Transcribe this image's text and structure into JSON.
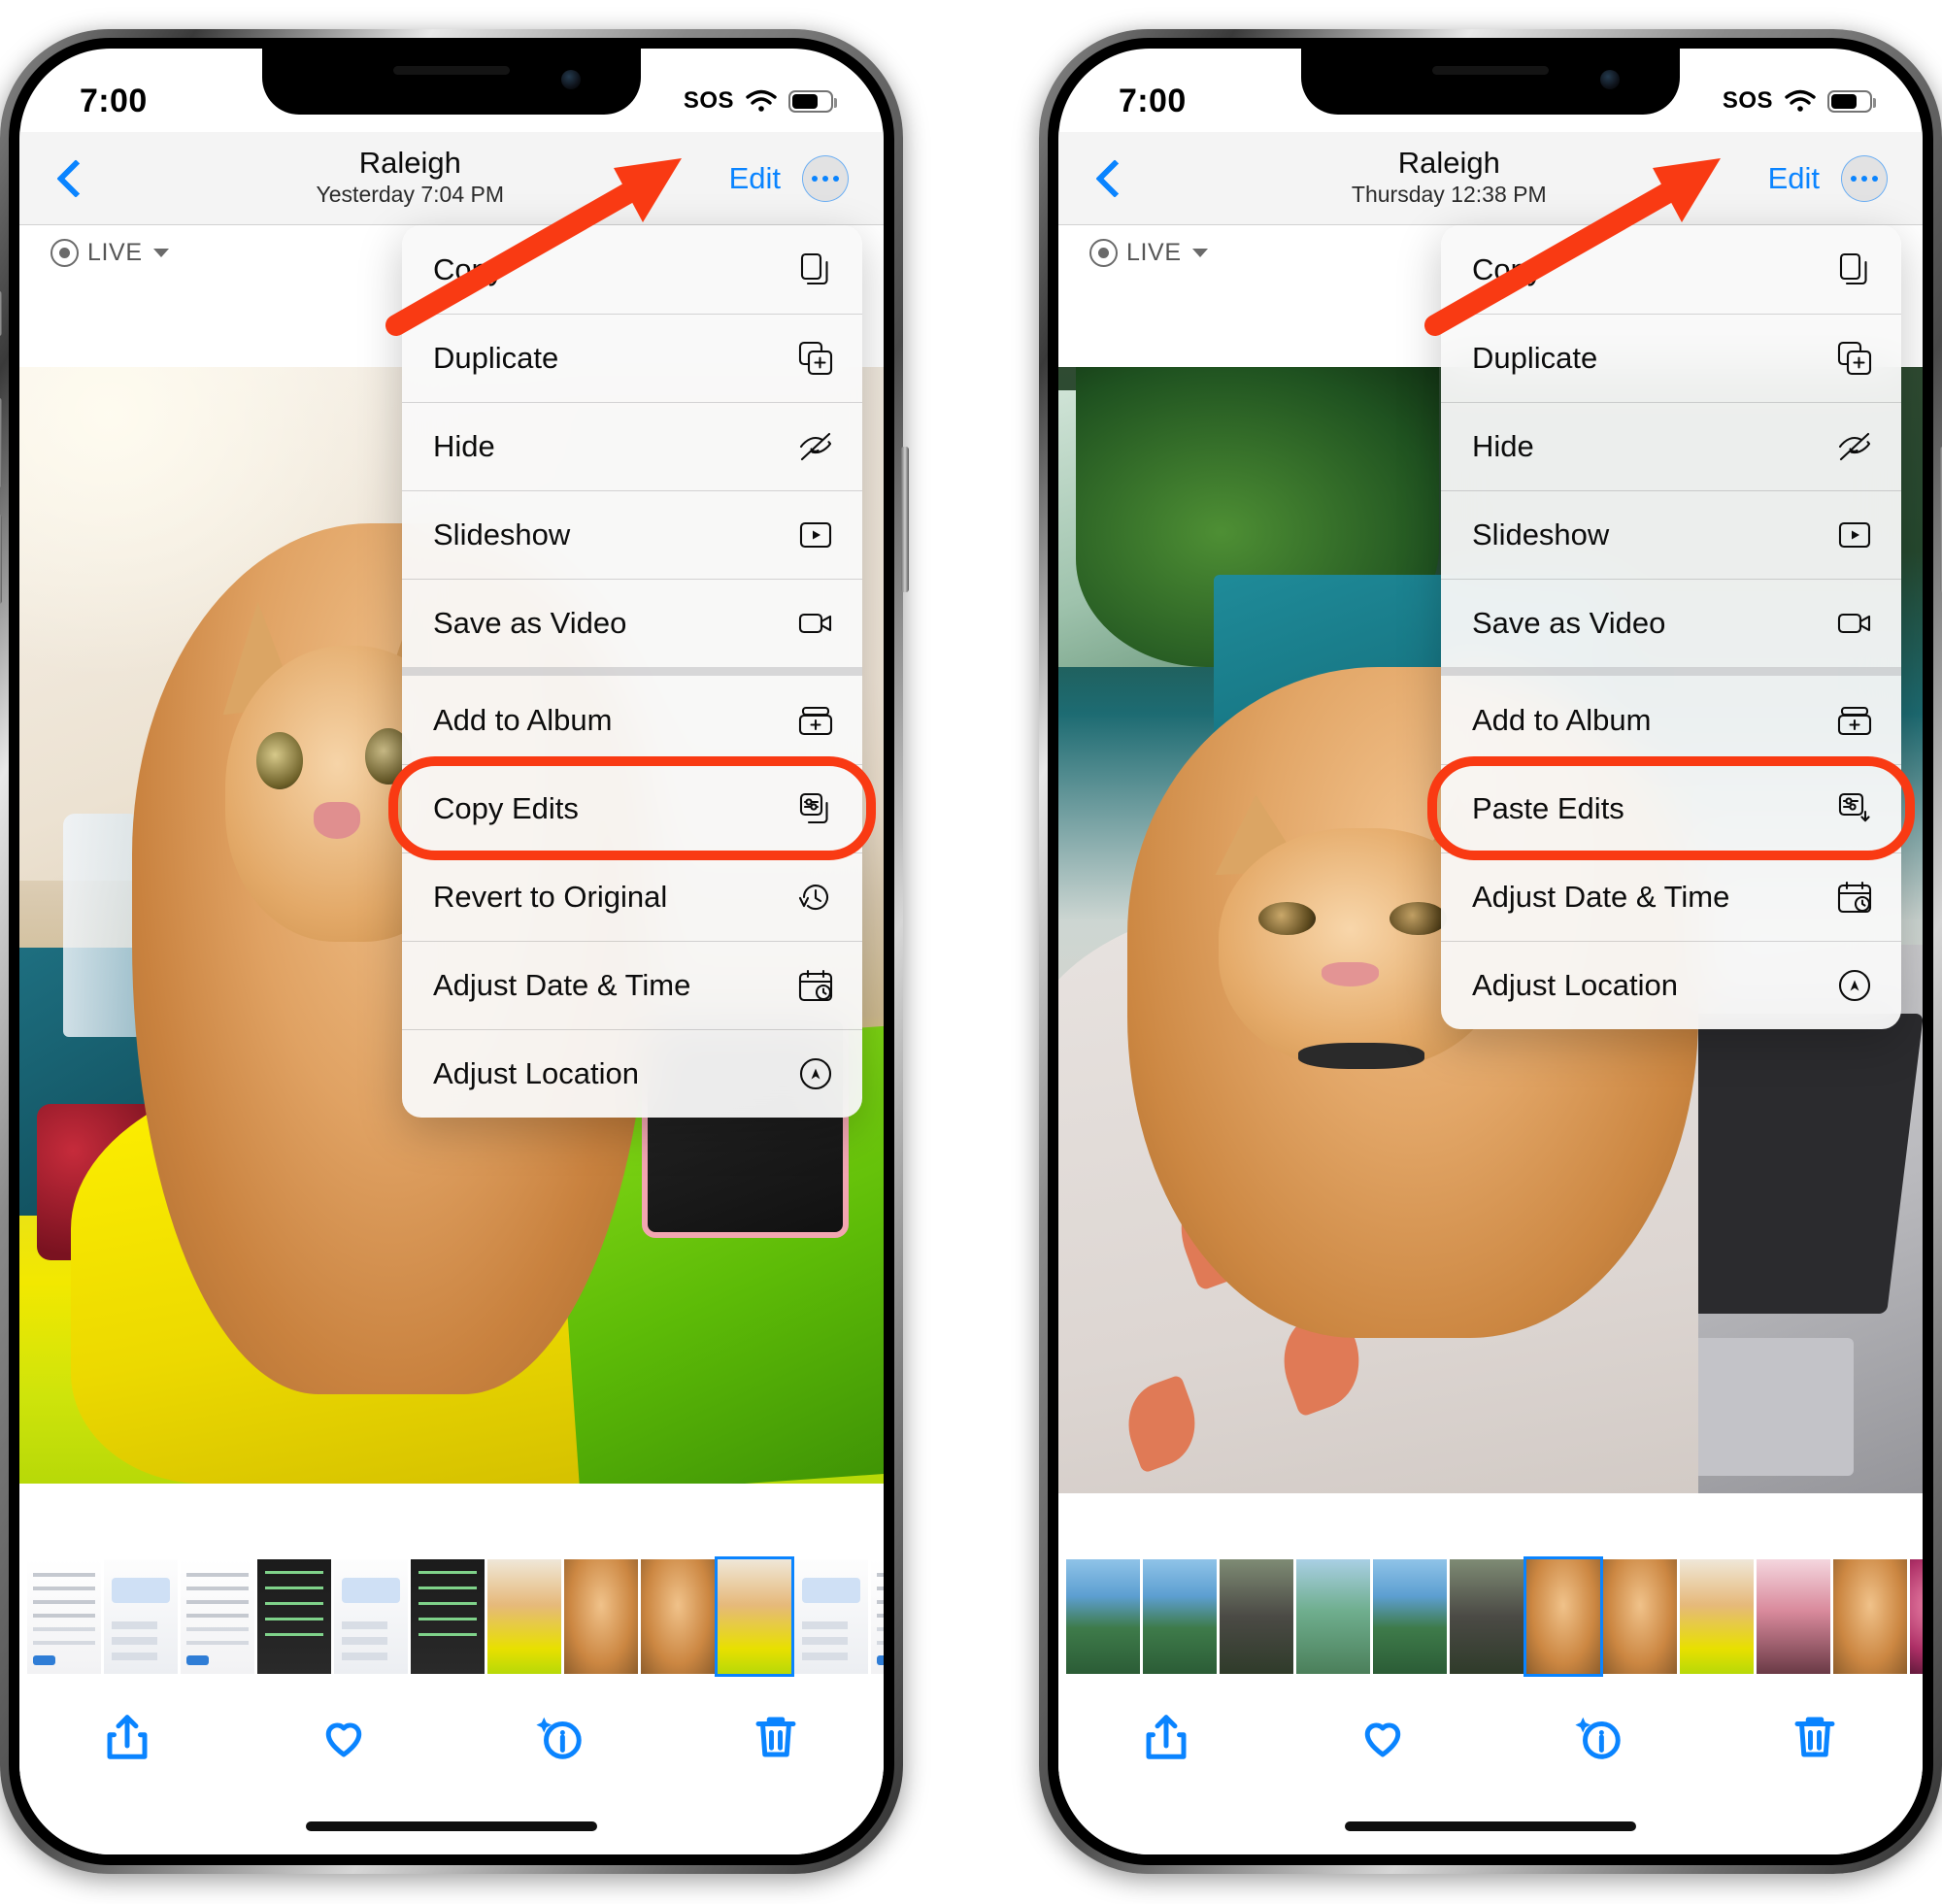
{
  "meta": {
    "accent_blue": "#0a84ff",
    "highlight_red": "#f93a13",
    "menu_bg": "#f9f9f9"
  },
  "phones": [
    {
      "id": "left",
      "status": {
        "time": "7:00",
        "sos": "SOS",
        "wifi": "wifi-icon",
        "battery": "battery-icon"
      },
      "nav": {
        "back": "back-chevron",
        "title": "Raleigh",
        "subtitle": "Yesterday  7:04 PM",
        "edit": "Edit",
        "more": "more-options"
      },
      "live_badge": {
        "label": "LIVE"
      },
      "menu": [
        [
          {
            "label": "Copy",
            "icon": "copy-icon"
          },
          {
            "label": "Duplicate",
            "icon": "duplicate-icon"
          },
          {
            "label": "Hide",
            "icon": "hide-eye-icon"
          },
          {
            "label": "Slideshow",
            "icon": "slideshow-icon"
          },
          {
            "label": "Save as Video",
            "icon": "video-camera-icon"
          }
        ],
        [
          {
            "label": "Add to Album",
            "icon": "add-to-album-icon"
          },
          {
            "label": "Copy Edits",
            "icon": "copy-edits-icon",
            "highlighted": true
          },
          {
            "label": "Revert to Original",
            "icon": "revert-icon"
          },
          {
            "label": "Adjust Date & Time",
            "icon": "calendar-clock-icon"
          },
          {
            "label": "Adjust Location",
            "icon": "location-icon"
          }
        ]
      ],
      "toolbar": [
        {
          "name": "share-button",
          "icon": "share-icon"
        },
        {
          "name": "favorite-button",
          "icon": "heart-icon"
        },
        {
          "name": "info-button",
          "icon": "info-sparkle-icon"
        },
        {
          "name": "delete-button",
          "icon": "trash-icon"
        }
      ],
      "filmstrip_selected_index": 6
    },
    {
      "id": "right",
      "status": {
        "time": "7:00",
        "sos": "SOS",
        "wifi": "wifi-icon",
        "battery": "battery-icon"
      },
      "nav": {
        "back": "back-chevron",
        "title": "Raleigh",
        "subtitle": "Thursday  12:38 PM",
        "edit": "Edit",
        "more": "more-options"
      },
      "live_badge": {
        "label": "LIVE"
      },
      "menu": [
        [
          {
            "label": "Copy",
            "icon": "copy-icon"
          },
          {
            "label": "Duplicate",
            "icon": "duplicate-icon"
          },
          {
            "label": "Hide",
            "icon": "hide-eye-icon"
          },
          {
            "label": "Slideshow",
            "icon": "slideshow-icon"
          },
          {
            "label": "Save as Video",
            "icon": "video-camera-icon"
          }
        ],
        [
          {
            "label": "Add to Album",
            "icon": "add-to-album-icon"
          },
          {
            "label": "Paste Edits",
            "icon": "paste-edits-icon",
            "highlighted": true
          },
          {
            "label": "Adjust Date & Time",
            "icon": "calendar-clock-icon"
          },
          {
            "label": "Adjust Location",
            "icon": "location-icon"
          }
        ]
      ],
      "toolbar": [
        {
          "name": "share-button",
          "icon": "share-icon"
        },
        {
          "name": "favorite-button",
          "icon": "heart-icon"
        },
        {
          "name": "info-button",
          "icon": "info-sparkle-icon"
        },
        {
          "name": "delete-button",
          "icon": "trash-icon"
        }
      ],
      "filmstrip_selected_index": 6
    }
  ],
  "annotations": [
    {
      "type": "arrow",
      "target": "more-options-button",
      "phone": "left",
      "color": "#f93a13"
    },
    {
      "type": "ring",
      "target": "Copy Edits",
      "phone": "left",
      "color": "#f93a13"
    },
    {
      "type": "arrow",
      "target": "more-options-button",
      "phone": "right",
      "color": "#f93a13"
    },
    {
      "type": "ring",
      "target": "Paste Edits",
      "phone": "right",
      "color": "#f93a13"
    }
  ]
}
